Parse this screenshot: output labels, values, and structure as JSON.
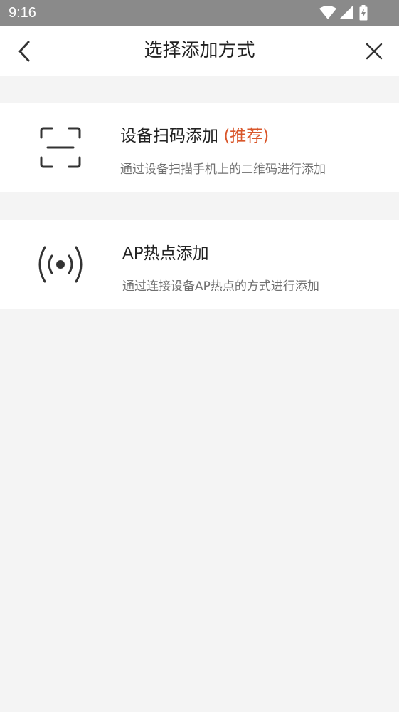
{
  "status_bar": {
    "time": "9:16",
    "icons": [
      "wifi-icon",
      "signal-icon",
      "battery-charging-icon"
    ]
  },
  "header": {
    "title": "选择添加方式",
    "back_icon": "chevron-left-icon",
    "close_icon": "close-icon"
  },
  "options": [
    {
      "icon": "scan-qr-icon",
      "title": "设备扫码添加",
      "tag": "(推荐)",
      "description": "通过设备扫描手机上的二维码进行添加"
    },
    {
      "icon": "ap-hotspot-icon",
      "title": "AP热点添加",
      "description": "通过连接设备AP热点的方式进行添加"
    }
  ],
  "colors": {
    "status_bar": "#8a8a8a",
    "background": "#f4f4f4",
    "card": "#ffffff",
    "accent": "#d9572b",
    "title_text": "#222222",
    "desc_text": "#707070"
  }
}
